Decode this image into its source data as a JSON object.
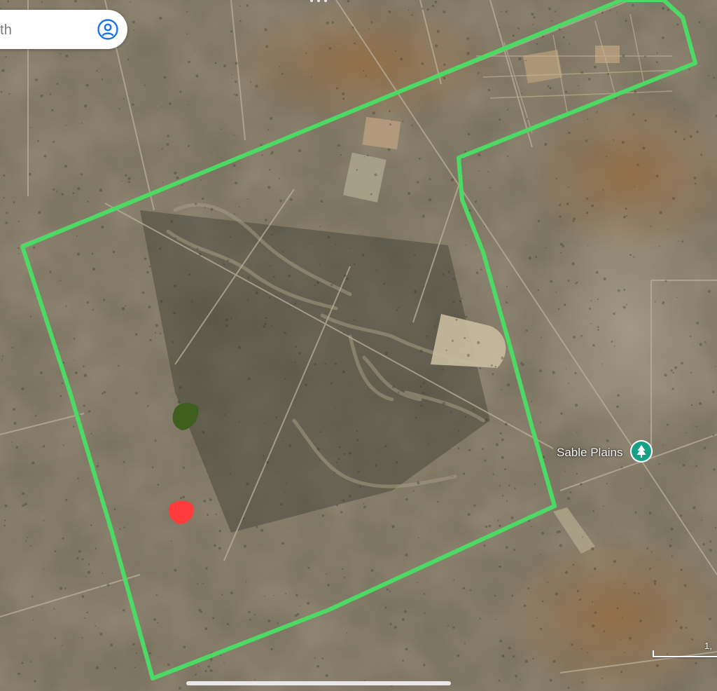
{
  "search": {
    "visible_text": "th",
    "account_icon": "account-circle-icon"
  },
  "map": {
    "type": "satellite",
    "place_label": {
      "name": "Sable Plains",
      "icon": "park-tree-icon",
      "pin_color": "#16a085"
    },
    "boundary": {
      "color": "#4cd964"
    },
    "markers": [
      {
        "color": "#3f5f1f",
        "icon": "dark-green-marker"
      },
      {
        "color": "#ff3b3b",
        "icon": "red-marker"
      }
    ],
    "scale_label": "1,"
  },
  "colors": {
    "background": "#6e6651",
    "boundary": "#4cd964",
    "accent": "#1a73e8"
  }
}
